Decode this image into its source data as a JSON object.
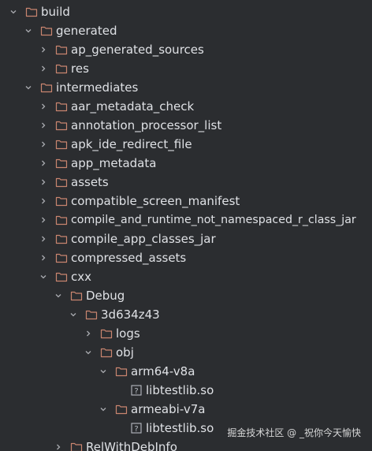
{
  "colors": {
    "background": "#2b2d30",
    "text": "#dfe1e5",
    "folder_stroke": "#c9856f",
    "chevron": "#a9abb0",
    "file_stroke": "#b7bbc2"
  },
  "tree": [
    {
      "label": "build",
      "icon": "folder-icon",
      "expanded": true
    },
    {
      "label": "generated",
      "icon": "folder-icon",
      "expanded": true
    },
    {
      "label": "ap_generated_sources",
      "icon": "folder-icon",
      "expanded": false
    },
    {
      "label": "res",
      "icon": "folder-icon",
      "expanded": false
    },
    {
      "label": "intermediates",
      "icon": "folder-icon",
      "expanded": true
    },
    {
      "label": "aar_metadata_check",
      "icon": "folder-icon",
      "expanded": false
    },
    {
      "label": "annotation_processor_list",
      "icon": "folder-icon",
      "expanded": false
    },
    {
      "label": "apk_ide_redirect_file",
      "icon": "folder-icon",
      "expanded": false
    },
    {
      "label": "app_metadata",
      "icon": "folder-icon",
      "expanded": false
    },
    {
      "label": "assets",
      "icon": "folder-icon",
      "expanded": false
    },
    {
      "label": "compatible_screen_manifest",
      "icon": "folder-icon",
      "expanded": false
    },
    {
      "label": "compile_and_runtime_not_namespaced_r_class_jar",
      "icon": "folder-icon",
      "expanded": false
    },
    {
      "label": "compile_app_classes_jar",
      "icon": "folder-icon",
      "expanded": false
    },
    {
      "label": "compressed_assets",
      "icon": "folder-icon",
      "expanded": false
    },
    {
      "label": "cxx",
      "icon": "folder-icon",
      "expanded": true
    },
    {
      "label": "Debug",
      "icon": "folder-icon",
      "expanded": true
    },
    {
      "label": "3d634z43",
      "icon": "folder-icon",
      "expanded": true
    },
    {
      "label": "logs",
      "icon": "folder-icon",
      "expanded": false
    },
    {
      "label": "obj",
      "icon": "folder-icon",
      "expanded": true
    },
    {
      "label": "arm64-v8a",
      "icon": "folder-icon",
      "expanded": true
    },
    {
      "label": "libtestlib.so",
      "icon": "unknown-file-icon",
      "expanded": null
    },
    {
      "label": "armeabi-v7a",
      "icon": "folder-icon",
      "expanded": true
    },
    {
      "label": "libtestlib.so",
      "icon": "unknown-file-icon",
      "expanded": null
    },
    {
      "label": "RelWithDebInfo",
      "icon": "folder-icon",
      "expanded": false
    }
  ],
  "watermark": "掘金技术社区 @ _祝你今天愉快"
}
